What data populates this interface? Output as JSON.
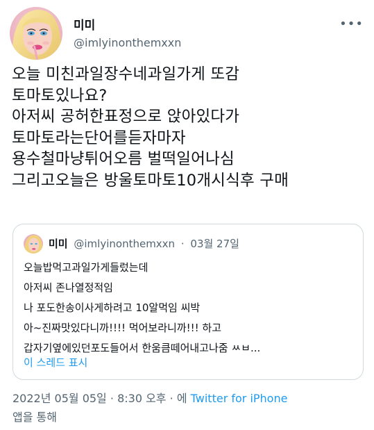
{
  "author": {
    "name": "미미",
    "handle": "@imlyinonthemxxn",
    "avatar_icon": "barbie-avatar-icon"
  },
  "more_icon": "more-options-icon",
  "tweet": {
    "lines": [
      "오늘 미친과일장수네과일가게 또감",
      "토마토있나요?",
      "아저씨 공허한표정으로 앉아있다가",
      "토마토라는단어를듣자마자",
      "용수철마냥튀어오름 벌떡일어나심",
      "그리고오늘은 방울토마토10개시식후 구매"
    ]
  },
  "quote": {
    "name": "미미",
    "handle": "@imlyinonthemxxn",
    "separator": "·",
    "date": "03월 27일",
    "lines": [
      "오늘밥먹고과일가게들렀는데",
      "아저씨 존나열정적임",
      "나 포도한송이사게하려고 10알먹임 씨박",
      "아~진짜맛있다니까!!!! 먹어보라니까!!! 하고",
      "갑자기옆에있던포도들어서 한움큼떼어내고나줌 ㅆㅂ..."
    ],
    "show_thread": "이 스레드 표시"
  },
  "footer": {
    "date": "2022년 05월 05일",
    "sep1": "·",
    "time": "8:30 오후",
    "sep2": "·",
    "via_prefix": "에",
    "source": "Twitter for iPhone",
    "via_suffix": "앱을 통해"
  },
  "colors": {
    "text": "#0f1419",
    "muted": "#536471",
    "link": "#1d9bf0",
    "border": "#cfd9de"
  }
}
